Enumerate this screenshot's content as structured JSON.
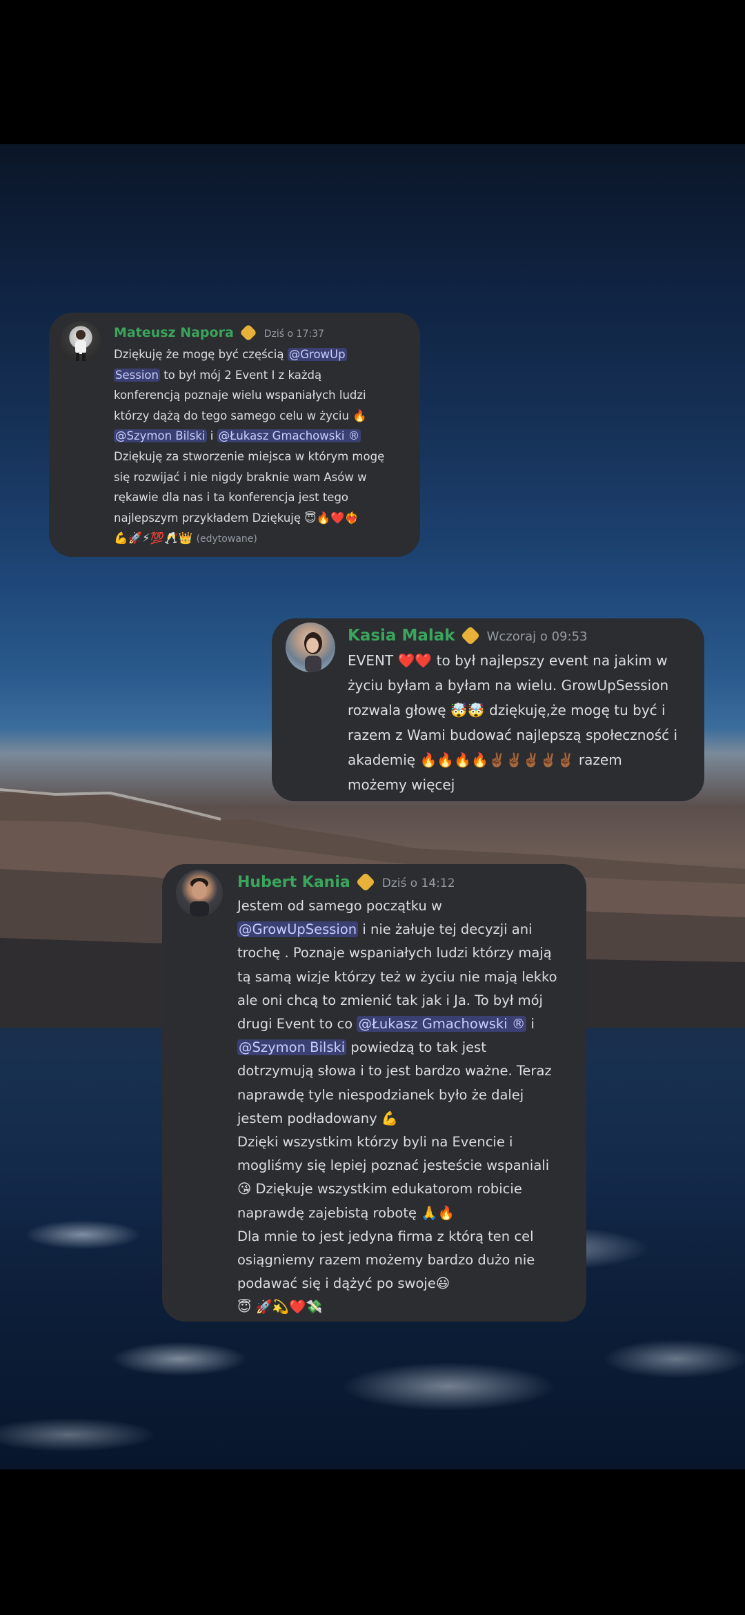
{
  "messages": [
    {
      "name": "Mateusz Napora",
      "timestamp": "Dziś o 17:37",
      "lines": [
        {
          "parts": [
            {
              "t": "Dziękuję że mogę być częścią "
            },
            {
              "t": "@GrowUp",
              "m": true
            }
          ]
        },
        {
          "parts": [
            {
              "t": "Session",
              "m": true
            },
            {
              "t": " to był mój 2 Event I z każdą"
            }
          ]
        },
        {
          "parts": [
            {
              "t": "konferencją poznaje wielu wspaniałych ludzi"
            }
          ]
        },
        {
          "parts": [
            {
              "t": "którzy dążą do tego samego celu w życiu 🔥"
            }
          ]
        },
        {
          "parts": [
            {
              "t": "@Szymon Bilski",
              "m": true
            },
            {
              "t": " i "
            },
            {
              "t": "@Łukasz Gmachowski ®",
              "m": true
            }
          ]
        },
        {
          "parts": [
            {
              "t": "Dziękuję za stworzenie miejsca w którym mogę"
            }
          ]
        },
        {
          "parts": [
            {
              "t": "się rozwijać i  nie nigdy  braknie wam Asów w"
            }
          ]
        },
        {
          "parts": [
            {
              "t": "rękawie dla nas i ta konferencja jest tego"
            }
          ]
        },
        {
          "parts": [
            {
              "t": "najlepszym przykładem Dziękuję 😇🔥❤️❤️‍🔥"
            }
          ]
        },
        {
          "parts": [
            {
              "t": "💪🚀⚡💯🥂👑 "
            },
            {
              "t": "(edytowane)",
              "e": true
            }
          ]
        }
      ]
    },
    {
      "name": "Kasia Malak",
      "timestamp": "Wczoraj o 09:53",
      "lines": [
        {
          "parts": [
            {
              "t": "EVENT ❤️❤️ to był najlepszy event na jakim w"
            }
          ]
        },
        {
          "parts": [
            {
              "t": "życiu byłam a byłam na wielu. GrowUpSession"
            }
          ]
        },
        {
          "parts": [
            {
              "t": "rozwala głowę 🤯🤯 dziękuję,że mogę tu być i"
            }
          ]
        },
        {
          "parts": [
            {
              "t": "razem z Wami budować najlepszą społeczność i"
            }
          ]
        },
        {
          "parts": [
            {
              "t": "akademię 🔥🔥🔥🔥✌🏾✌🏾✌🏾✌🏾✌🏾 razem"
            }
          ]
        },
        {
          "parts": [
            {
              "t": "możemy więcej"
            }
          ]
        }
      ]
    },
    {
      "name": "Hubert Kania",
      "timestamp": "Dziś o 14:12",
      "lines": [
        {
          "parts": [
            {
              "t": "Jestem od samego początku w"
            }
          ]
        },
        {
          "parts": [
            {
              "t": "@GrowUpSession",
              "m": true
            },
            {
              "t": " i nie żałuje tej decyzji ani"
            }
          ]
        },
        {
          "parts": [
            {
              "t": "trochę . Poznaje wspaniałych ludzi którzy mają"
            }
          ]
        },
        {
          "parts": [
            {
              "t": "tą samą wizje którzy też w życiu nie mają lekko"
            }
          ]
        },
        {
          "parts": [
            {
              "t": "ale oni chcą to zmienić tak jak i Ja. To był mój"
            }
          ]
        },
        {
          "parts": [
            {
              "t": "drugi Event to co "
            },
            {
              "t": "@Łukasz Gmachowski ®",
              "m": true
            },
            {
              "t": " i"
            }
          ]
        },
        {
          "parts": [
            {
              "t": "@Szymon Bilski",
              "m": true
            },
            {
              "t": " powiedzą to tak jest"
            }
          ]
        },
        {
          "parts": [
            {
              "t": "dotrzymują słowa i to jest bardzo ważne. Teraz"
            }
          ]
        },
        {
          "parts": [
            {
              "t": "naprawdę tyle niespodzianek było że dalej"
            }
          ]
        },
        {
          "parts": [
            {
              "t": "jestem podładowany 💪"
            }
          ]
        },
        {
          "parts": [
            {
              "t": "Dzięki wszystkim którzy byli na Evencie i"
            }
          ]
        },
        {
          "parts": [
            {
              "t": "mogliśmy się lepiej poznać jesteście wspaniali"
            }
          ]
        },
        {
          "parts": [
            {
              "t": "😘 Dziękuje wszystkim edukatorom robicie"
            }
          ]
        },
        {
          "parts": [
            {
              "t": "naprawdę zajebistą robotę 🙏🔥"
            }
          ]
        },
        {
          "parts": [
            {
              "t": "Dla mnie to jest jedyna firma z którą ten cel"
            }
          ]
        },
        {
          "parts": [
            {
              "t": "osiągniemy razem możemy bardzo dużo nie"
            }
          ]
        },
        {
          "parts": [
            {
              "t": "podawać się i dążyć po swoje😃"
            }
          ]
        },
        {
          "parts": [
            {
              "t": "😇 🚀💫❤️💸"
            }
          ]
        }
      ]
    }
  ]
}
